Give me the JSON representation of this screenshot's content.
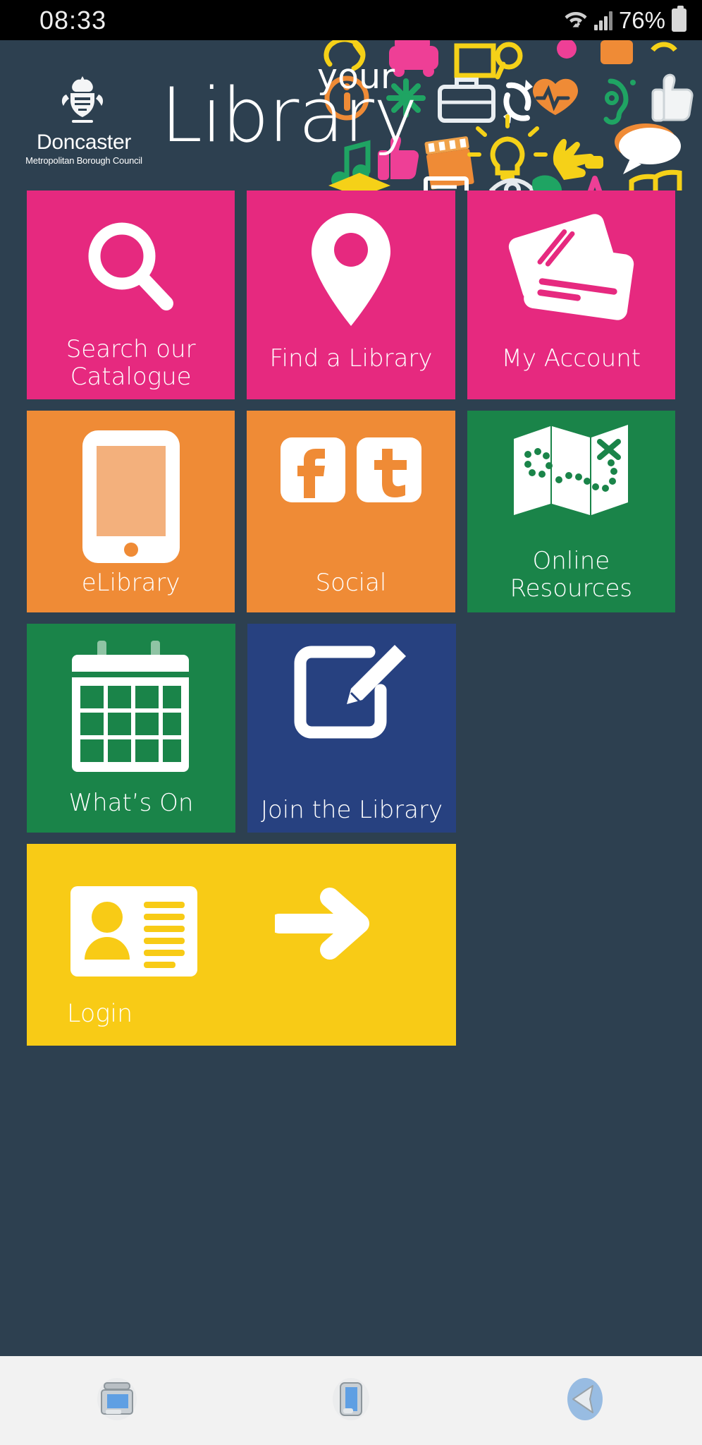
{
  "status_bar": {
    "time": "08:33",
    "battery_percent": "76%",
    "icons": [
      "wifi-icon",
      "signal-icon",
      "battery-icon"
    ]
  },
  "header": {
    "council_name": "Doncaster",
    "council_subtitle": "Metropolitan Borough Council",
    "brand_super": "your",
    "brand_main": "Library",
    "crest_icon": "coat-of-arms-crest",
    "collage_icons": [
      "lasso-icon",
      "car-icon",
      "phone-icon",
      "info-icon",
      "asterisk-icon",
      "briefcase-icon",
      "refresh-icon",
      "heartbeat-icon",
      "ear-icon",
      "thumbs-up-icon",
      "music-note-icon",
      "thumbs-up-pink-icon",
      "film-clapper-icon",
      "lightbulb-icon",
      "hand-icon",
      "speech-bubble-icon",
      "star-icon",
      "graduation-cap-icon",
      "document-icon",
      "eye-icon",
      "book-icon"
    ]
  },
  "tiles": [
    {
      "id": "search-catalogue",
      "label": "Search our Catalogue",
      "color": "#e6297f",
      "icon": "magnifier-icon"
    },
    {
      "id": "find-library",
      "label": "Find a Library",
      "color": "#e6297f",
      "icon": "map-pin-icon"
    },
    {
      "id": "my-account",
      "label": "My Account",
      "color": "#e6297f",
      "icon": "library-cards-icon"
    },
    {
      "id": "elibrary",
      "label": "eLibrary",
      "color": "#ef8b36",
      "icon": "tablet-icon"
    },
    {
      "id": "social",
      "label": "Social",
      "color": "#ef8b36",
      "icon": "facebook-icon,twitter-icon"
    },
    {
      "id": "online-resources",
      "label": "Online Resources",
      "color": "#1a8449",
      "icon": "treasure-map-icon"
    },
    {
      "id": "whats-on",
      "label": "What’s On",
      "color": "#1a8449",
      "icon": "calendar-icon"
    },
    {
      "id": "join-library",
      "label": "Join the Library",
      "color": "#274180",
      "icon": "edit-pencil-square-icon"
    },
    {
      "id": "login",
      "label": "Login",
      "color": "#f8cb16",
      "icon": "id-card-icon,arrow-right-icon"
    }
  ],
  "nav_bar": {
    "buttons": [
      {
        "id": "recents",
        "icon": "recents-icon"
      },
      {
        "id": "home",
        "icon": "home-icon"
      },
      {
        "id": "back",
        "icon": "back-arrow-icon"
      }
    ]
  },
  "colors": {
    "background": "#2d4050",
    "pink": "#e6297f",
    "orange": "#ef8b36",
    "green": "#1a8449",
    "navy": "#274180",
    "yellow": "#f8cb16",
    "navbar": "#f2f2f2"
  }
}
